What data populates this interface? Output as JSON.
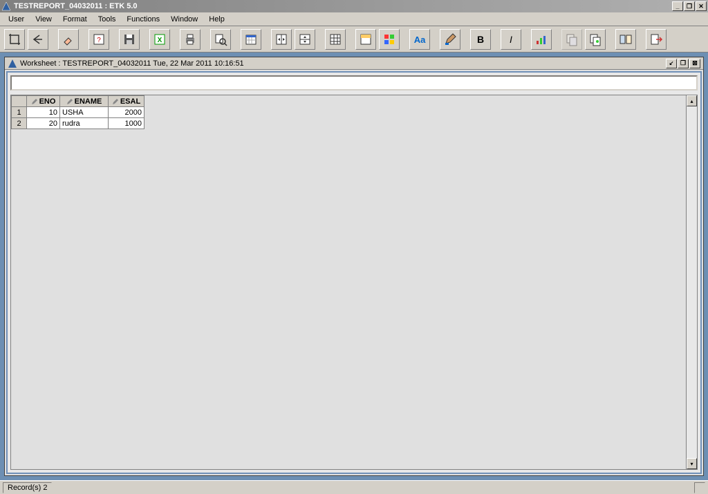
{
  "app": {
    "title": "TESTREPORT_04032011 : ETK 5.0"
  },
  "menu": {
    "items": [
      "User",
      "View",
      "Format",
      "Tools",
      "Functions",
      "Window",
      "Help"
    ]
  },
  "toolbar": {
    "buttons": [
      {
        "name": "crop-icon",
        "disabled": false
      },
      {
        "name": "undo-icon",
        "disabled": false
      },
      {
        "sep": true
      },
      {
        "name": "eraser-icon",
        "disabled": false
      },
      {
        "sep": true
      },
      {
        "name": "refresh-icon",
        "disabled": false
      },
      {
        "sep": true
      },
      {
        "name": "save-icon",
        "disabled": false
      },
      {
        "sep": true
      },
      {
        "name": "excel-icon",
        "disabled": false
      },
      {
        "sep": true
      },
      {
        "name": "print-icon",
        "disabled": false
      },
      {
        "sep": true
      },
      {
        "name": "preview-icon",
        "disabled": false
      },
      {
        "sep": true
      },
      {
        "name": "calendar-icon",
        "disabled": false
      },
      {
        "sep": true
      },
      {
        "name": "table-width-icon",
        "disabled": false
      },
      {
        "name": "table-height-icon",
        "disabled": false
      },
      {
        "sep": true
      },
      {
        "name": "grid-icon",
        "disabled": false
      },
      {
        "sep": true
      },
      {
        "name": "fill-icon",
        "disabled": false
      },
      {
        "name": "palette-icon",
        "disabled": false
      },
      {
        "sep": true
      },
      {
        "name": "font-blue-icon",
        "disabled": false
      },
      {
        "sep": true
      },
      {
        "name": "brush-icon",
        "disabled": false
      },
      {
        "sep": true
      },
      {
        "name": "bold-icon",
        "label": "B",
        "disabled": false
      },
      {
        "sep": true
      },
      {
        "name": "italic-icon",
        "label": "I",
        "disabled": false
      },
      {
        "sep": true
      },
      {
        "name": "chart-icon",
        "disabled": false
      },
      {
        "sep": true
      },
      {
        "name": "copy1-icon",
        "disabled": true
      },
      {
        "name": "copy2-icon",
        "disabled": false
      },
      {
        "sep": true
      },
      {
        "name": "panels-icon",
        "disabled": false
      },
      {
        "sep": true
      },
      {
        "name": "exit-icon",
        "disabled": false
      }
    ]
  },
  "worksheet": {
    "title": "Worksheet : TESTREPORT_04032011 Tue, 22 Mar 2011 10:16:51",
    "columns": [
      "ENO",
      "ENAME",
      "ESAL"
    ],
    "rows": [
      {
        "n": "1",
        "ENO": "10",
        "ENAME": "USHA",
        "ESAL": "2000"
      },
      {
        "n": "2",
        "ENO": "20",
        "ENAME": "rudra",
        "ESAL": "1000"
      }
    ]
  },
  "status": {
    "records": "Record(s) 2"
  }
}
